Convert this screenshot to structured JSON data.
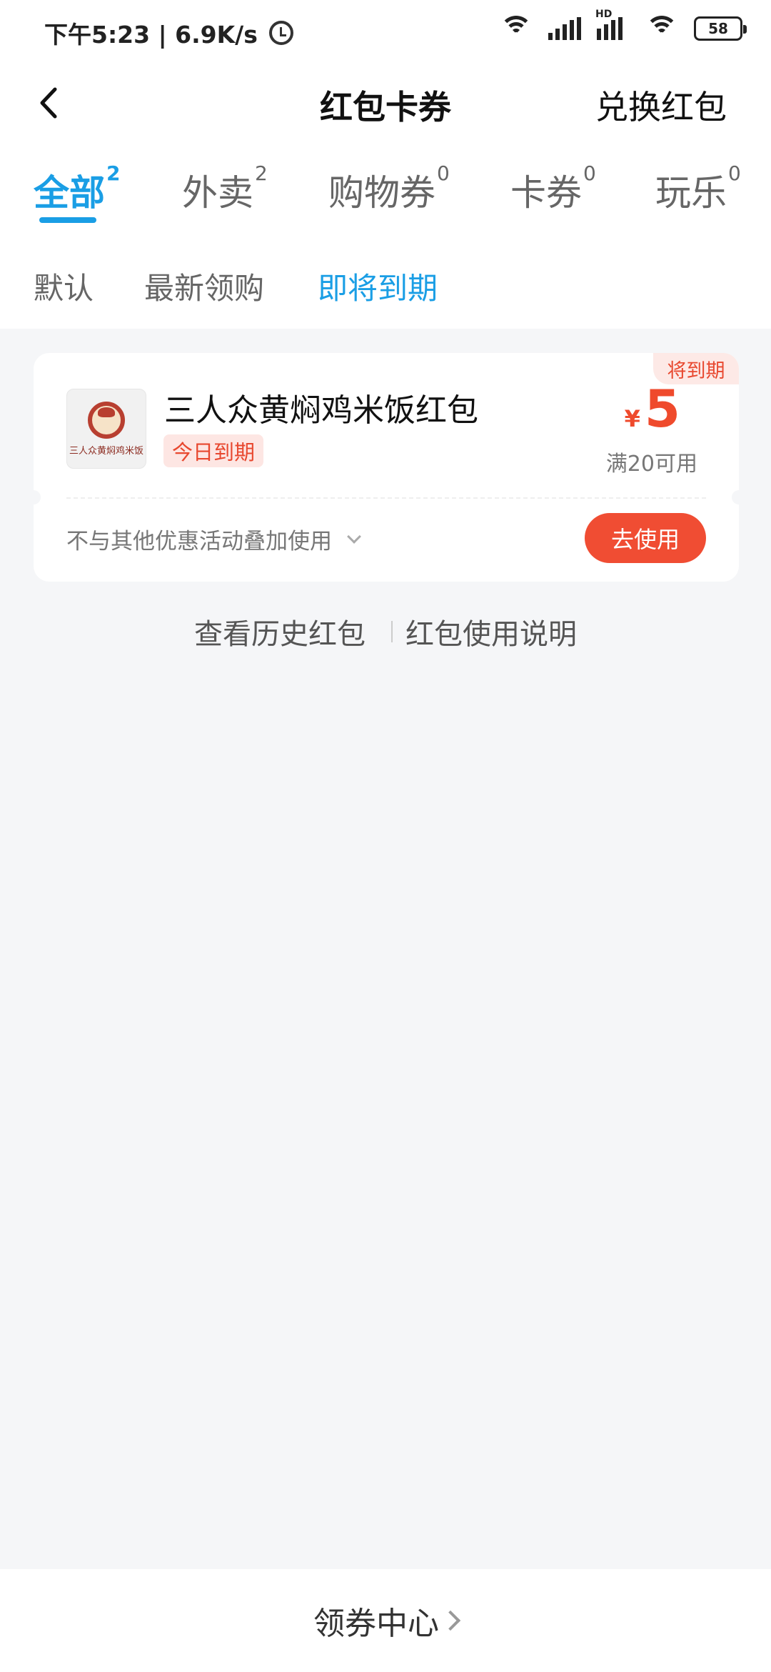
{
  "status_bar": {
    "time_speed": "下午5:23 | 6.9K/s",
    "hd": "HD",
    "battery": "58"
  },
  "header": {
    "title": "红包卡券",
    "exchange": "兑换红包"
  },
  "tabs": [
    {
      "label": "全部",
      "count": "2"
    },
    {
      "label": "外卖",
      "count": "2"
    },
    {
      "label": "购物券",
      "count": "0"
    },
    {
      "label": "卡券",
      "count": "0"
    },
    {
      "label": "玩乐",
      "count": "0"
    }
  ],
  "sorts": [
    "默认",
    "最新领购",
    "即将到期"
  ],
  "coupon": {
    "tag": "将到期",
    "logo_text": "三人众黄焖鸡米饭",
    "name": "三人众黄焖鸡米饭红包",
    "badge": "今日到期",
    "currency": "¥",
    "amount": "5",
    "condition": "满20可用",
    "rule": "不与其他优惠活动叠加使用",
    "button": "去使用"
  },
  "links": {
    "history": "查看历史红包",
    "instructions": "红包使用说明"
  },
  "footer": {
    "label": "领券中心"
  },
  "colors": {
    "accent": "#1a9ee5",
    "red": "#f04d33"
  }
}
